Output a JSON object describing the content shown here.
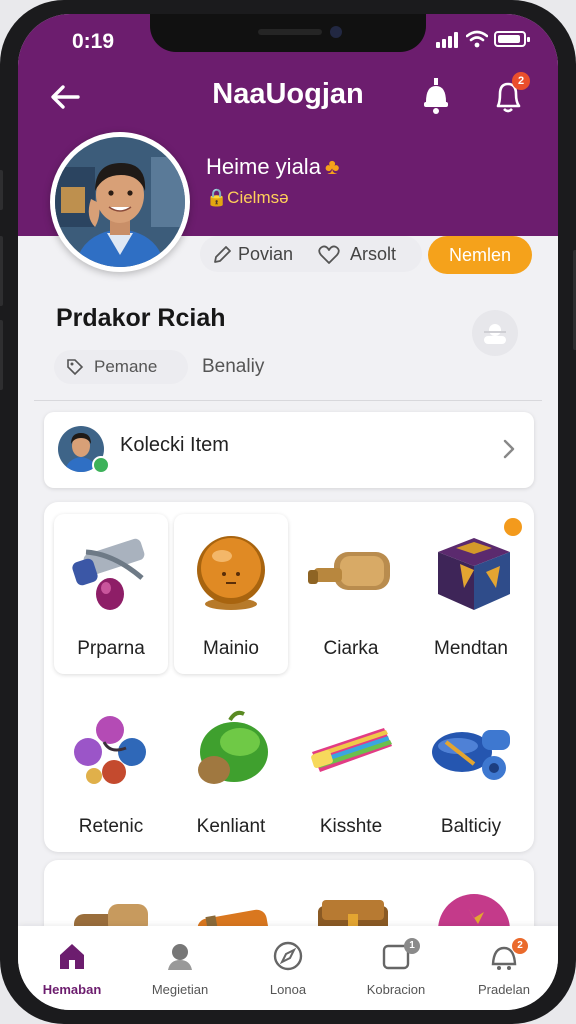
{
  "status_bar": {
    "time": "0:19"
  },
  "header": {
    "title": "NaaUogjan",
    "back_icon": "arrow-left-icon",
    "bell_badge": "2",
    "accent": "#6c1d6e"
  },
  "profile": {
    "name": "Heime yiala",
    "subtitle": "Cielmsə",
    "chips": [
      {
        "label": "Povian",
        "icon": "pencil-icon"
      },
      {
        "label": "Arsolt",
        "icon": "heart-icon"
      }
    ],
    "follow_label": "Nemlen",
    "follow_color": "#f5a21b"
  },
  "section": {
    "title": "Prdakor Rciah",
    "filters": [
      {
        "label": "Pemane",
        "icon": "tag-icon"
      },
      {
        "label": "Benaliy"
      }
    ]
  },
  "collection": {
    "label": "Kolecki Item"
  },
  "items": [
    {
      "label": "Prparna",
      "icon": "telescope-icon"
    },
    {
      "label": "Mainio",
      "icon": "orange-ball-icon"
    },
    {
      "label": "Ciarka",
      "icon": "scroll-icon"
    },
    {
      "label": "Mendtan",
      "icon": "cube-icon",
      "badge": ""
    },
    {
      "label": "Retenic",
      "icon": "gems-icon"
    },
    {
      "label": "Kenliant",
      "icon": "green-fruit-icon"
    },
    {
      "label": "Kisshte",
      "icon": "candy-icon"
    },
    {
      "label": "Balticiy",
      "icon": "blue-bolt-icon"
    }
  ],
  "tabs": [
    {
      "label": "Hemaban",
      "icon": "home-icon",
      "active": true
    },
    {
      "label": "Megietian",
      "icon": "person-icon"
    },
    {
      "label": "Lonoa",
      "icon": "compass-icon"
    },
    {
      "label": "Kobracion",
      "icon": "box-icon",
      "badge": "1"
    },
    {
      "label": "Pradelan",
      "icon": "cart-icon",
      "badge": "2"
    }
  ]
}
